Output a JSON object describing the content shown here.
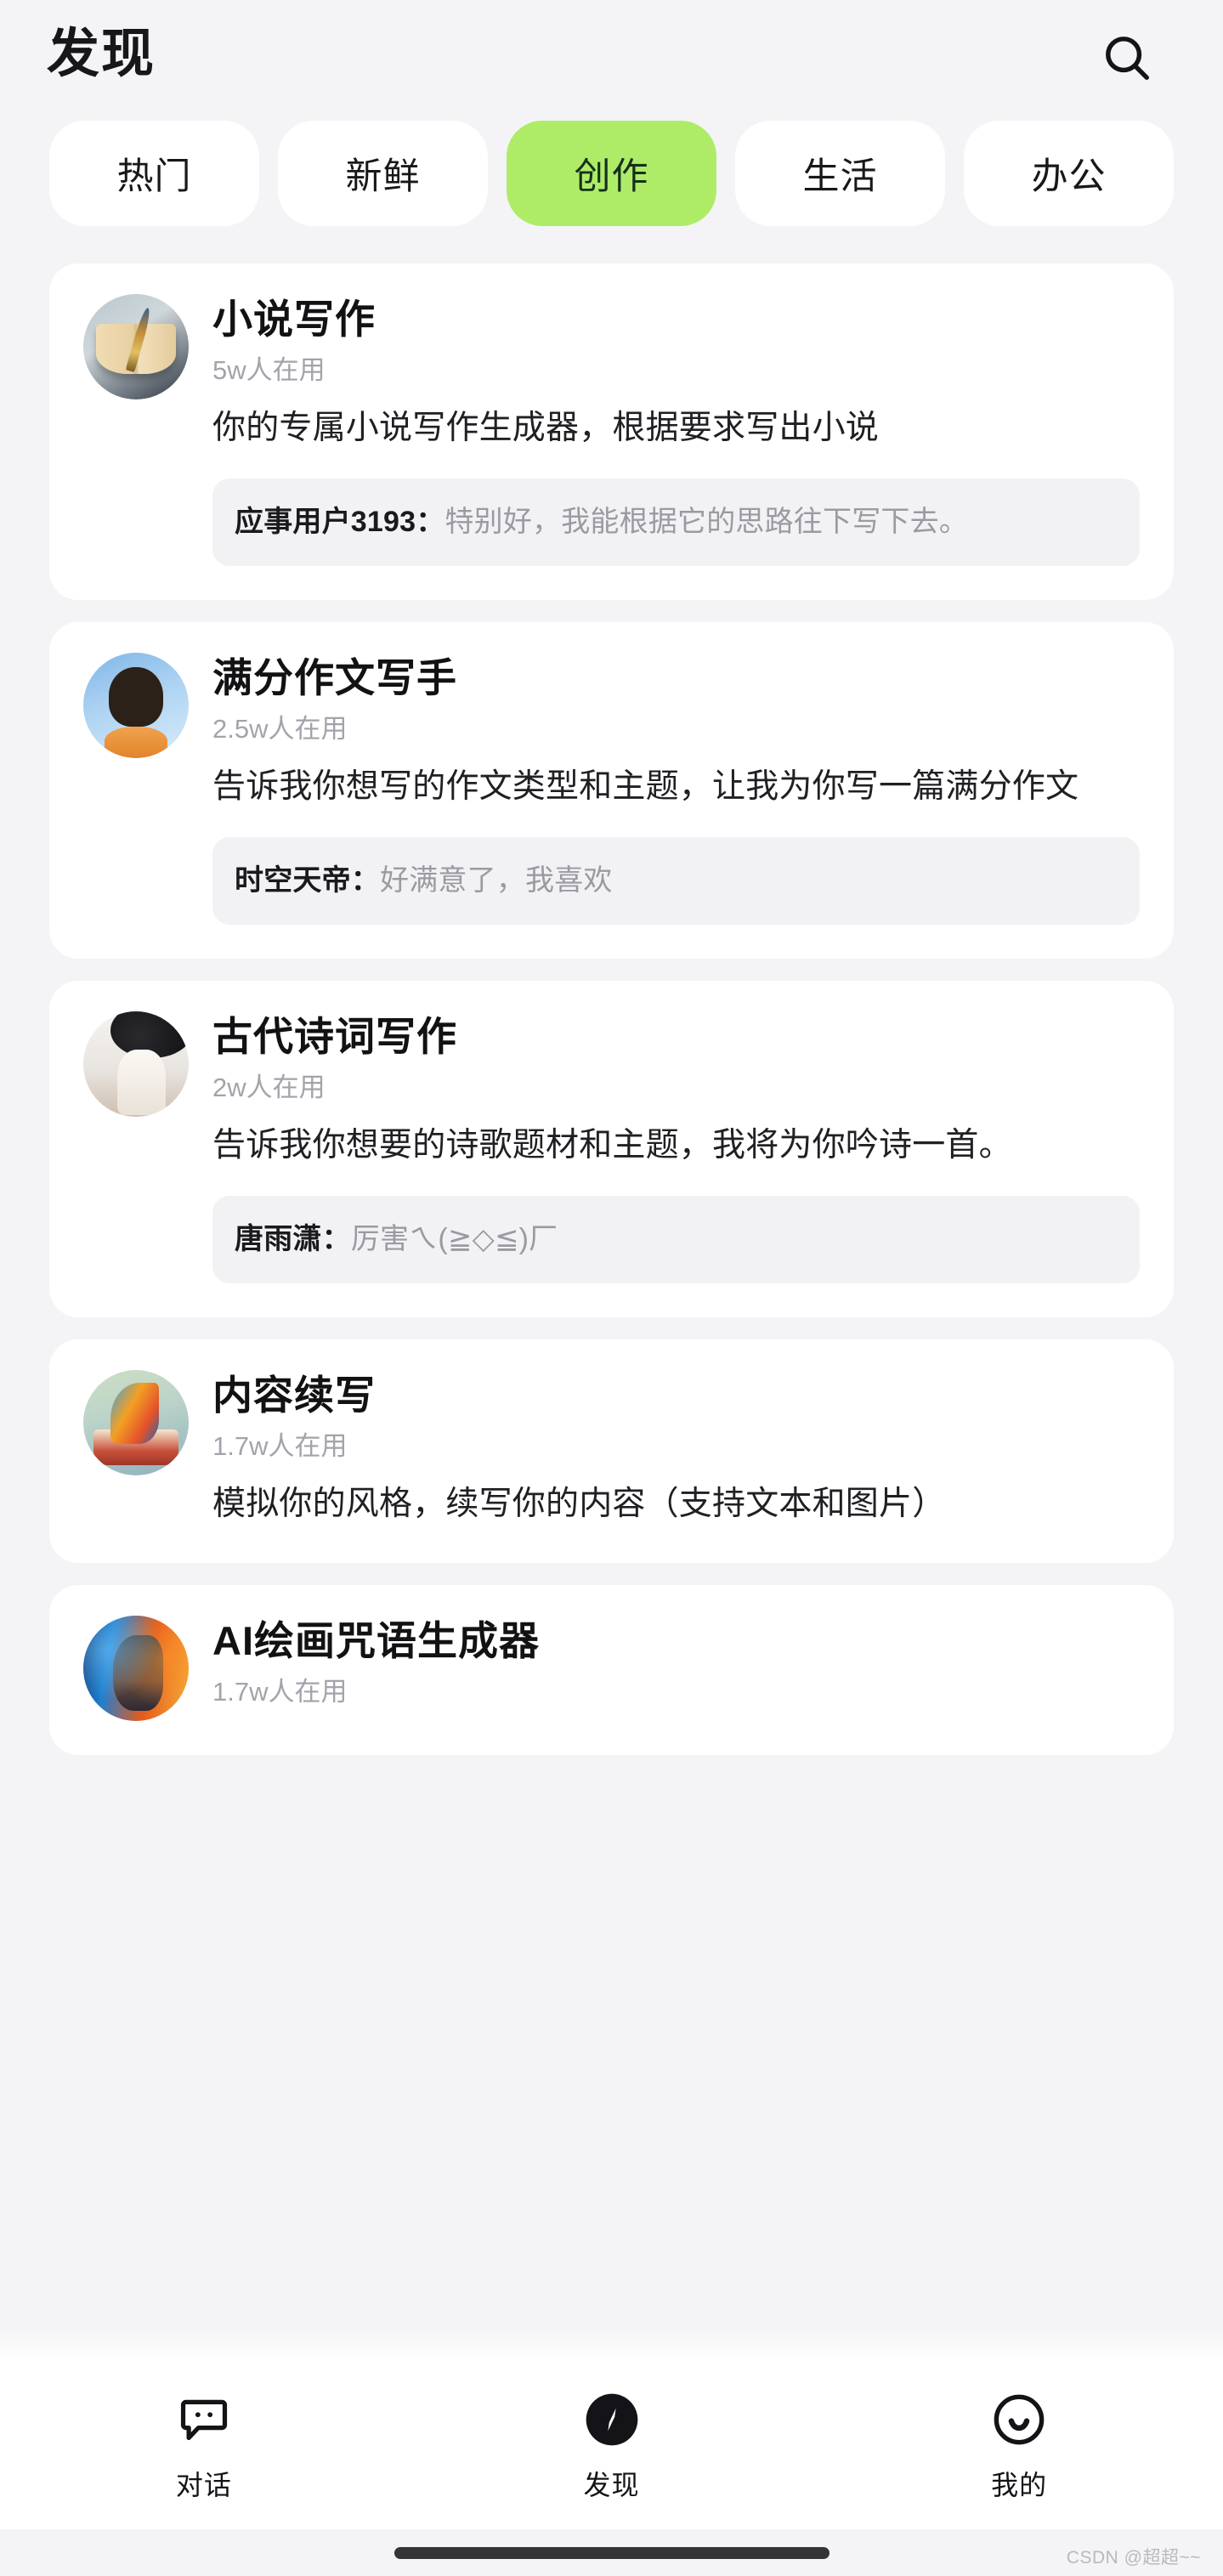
{
  "header": {
    "title": "发现",
    "search_icon": "search-icon"
  },
  "tabs": [
    {
      "label": "热门",
      "active": false
    },
    {
      "label": "新鲜",
      "active": false
    },
    {
      "label": "创作",
      "active": true
    },
    {
      "label": "生活",
      "active": false
    },
    {
      "label": "办公",
      "active": false
    }
  ],
  "accent_color": "#aeec68",
  "cards": [
    {
      "title": "小说写作",
      "users": "5w人在用",
      "desc": "你的专属小说写作生成器，根据要求写出小说",
      "comment_user": "应事用户3193：",
      "comment_text": "特别好，我能根据它的思路往下写下去。"
    },
    {
      "title": "满分作文写手",
      "users": "2.5w人在用",
      "desc": "告诉我你想写的作文类型和主题，让我为你写一篇满分作文",
      "comment_user": "时空天帝：",
      "comment_text": "好满意了，我喜欢"
    },
    {
      "title": "古代诗词写作",
      "users": "2w人在用",
      "desc": "告诉我你想要的诗歌题材和主题，我将为你吟诗一首。",
      "comment_user": "唐雨潇：",
      "comment_text": "厉害ㄟ(≧◇≦)厂"
    },
    {
      "title": "内容续写",
      "users": "1.7w人在用",
      "desc": "模拟你的风格，续写你的内容（支持文本和图片）",
      "comment_user": "",
      "comment_text": ""
    },
    {
      "title": "AI绘画咒语生成器",
      "users": "1.7w人在用",
      "desc": "",
      "comment_user": "",
      "comment_text": ""
    }
  ],
  "bottom_nav": [
    {
      "label": "对话",
      "icon": "chat-bubble-icon",
      "active": false
    },
    {
      "label": "发现",
      "icon": "compass-icon",
      "active": true
    },
    {
      "label": "我的",
      "icon": "smiley-face-icon",
      "active": false
    }
  ],
  "watermark": "CSDN @超超~~"
}
